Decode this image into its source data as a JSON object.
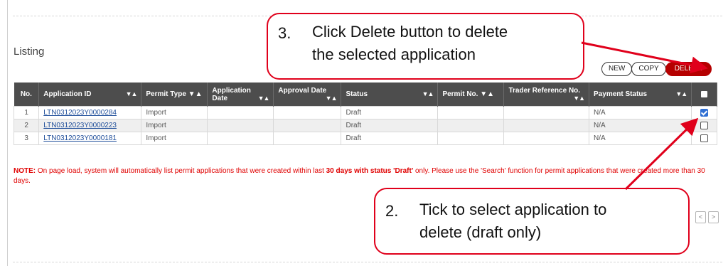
{
  "listing_title": "Listing",
  "buttons": {
    "new": "NEW",
    "copy": "COPY",
    "delete": "DELETE"
  },
  "table": {
    "headers": {
      "no": "No.",
      "application_id": "Application ID",
      "permit_type": "Permit Type",
      "application_date_1": "Application",
      "application_date_2": "Date",
      "approval_date": "Approval Date",
      "status": "Status",
      "permit_no": "Permit No.",
      "trader_ref": "Trader Reference No.",
      "payment_status": "Payment Status"
    },
    "sort_glyph": "▼▲",
    "rows": [
      {
        "no": "1",
        "application_id": "LTN0312023Y0000284",
        "permit_type": "Import",
        "application_date": "",
        "approval_date": "",
        "status": "Draft",
        "permit_no": "",
        "trader_ref": "",
        "payment_status": "N/A",
        "checked": true
      },
      {
        "no": "2",
        "application_id": "LTN0312023Y0000223",
        "permit_type": "Import",
        "application_date": "",
        "approval_date": "",
        "status": "Draft",
        "permit_no": "",
        "trader_ref": "",
        "payment_status": "N/A",
        "checked": false
      },
      {
        "no": "3",
        "application_id": "LTN0312023Y0000181",
        "permit_type": "Import",
        "application_date": "",
        "approval_date": "",
        "status": "Draft",
        "permit_no": "",
        "trader_ref": "",
        "payment_status": "N/A",
        "checked": false
      }
    ]
  },
  "note": {
    "label": "NOTE:",
    "part1": " On page load, system will automatically list permit applications that were created within last ",
    "bold1": "30 days with status 'Draft'",
    "part2": " only. Please use the 'Search' function for permit applications that were created more than 30 days."
  },
  "callouts": {
    "delete": {
      "num": "3.",
      "line1": "Click Delete button to delete",
      "line2": "the selected application"
    },
    "tick": {
      "num": "2.",
      "line1": "Tick to select application to",
      "line2": "delete (draft only)"
    }
  },
  "pager": {
    "prev": "<",
    "next": ">"
  },
  "colors": {
    "header_bg": "#4d4d4d",
    "delete_btn": "#b50000",
    "callout_red": "#e0001b",
    "note_red": "#e00000",
    "link": "#1f4e9a"
  }
}
